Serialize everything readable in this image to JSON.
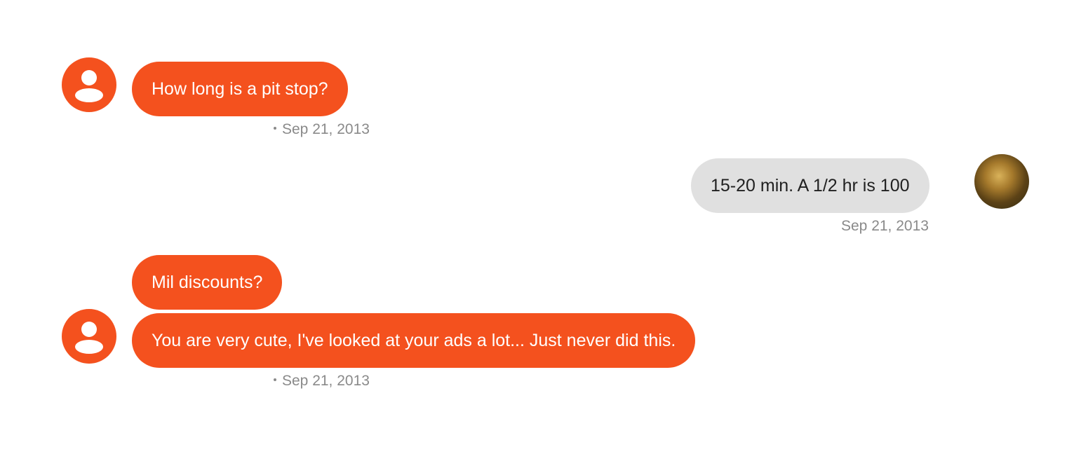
{
  "colors": {
    "incoming_bubble": "#f4511e",
    "outgoing_bubble": "#e0e0e0",
    "timestamp": "#8a8a8a"
  },
  "messages": [
    {
      "direction": "incoming",
      "avatar": "person-icon",
      "text": "How long is a pit stop?",
      "timestamp": "Sep 21, 2013"
    },
    {
      "direction": "outgoing",
      "avatar": "user-photo",
      "text": "15-20 min. A 1/2 hr is 100",
      "timestamp": "Sep 21, 2013"
    },
    {
      "direction": "incoming",
      "text": "Mil discounts?"
    },
    {
      "direction": "incoming",
      "avatar": "person-icon",
      "text": "You are very cute, I've looked at your ads a lot... Just never did this.",
      "timestamp": "Sep 21, 2013"
    }
  ]
}
